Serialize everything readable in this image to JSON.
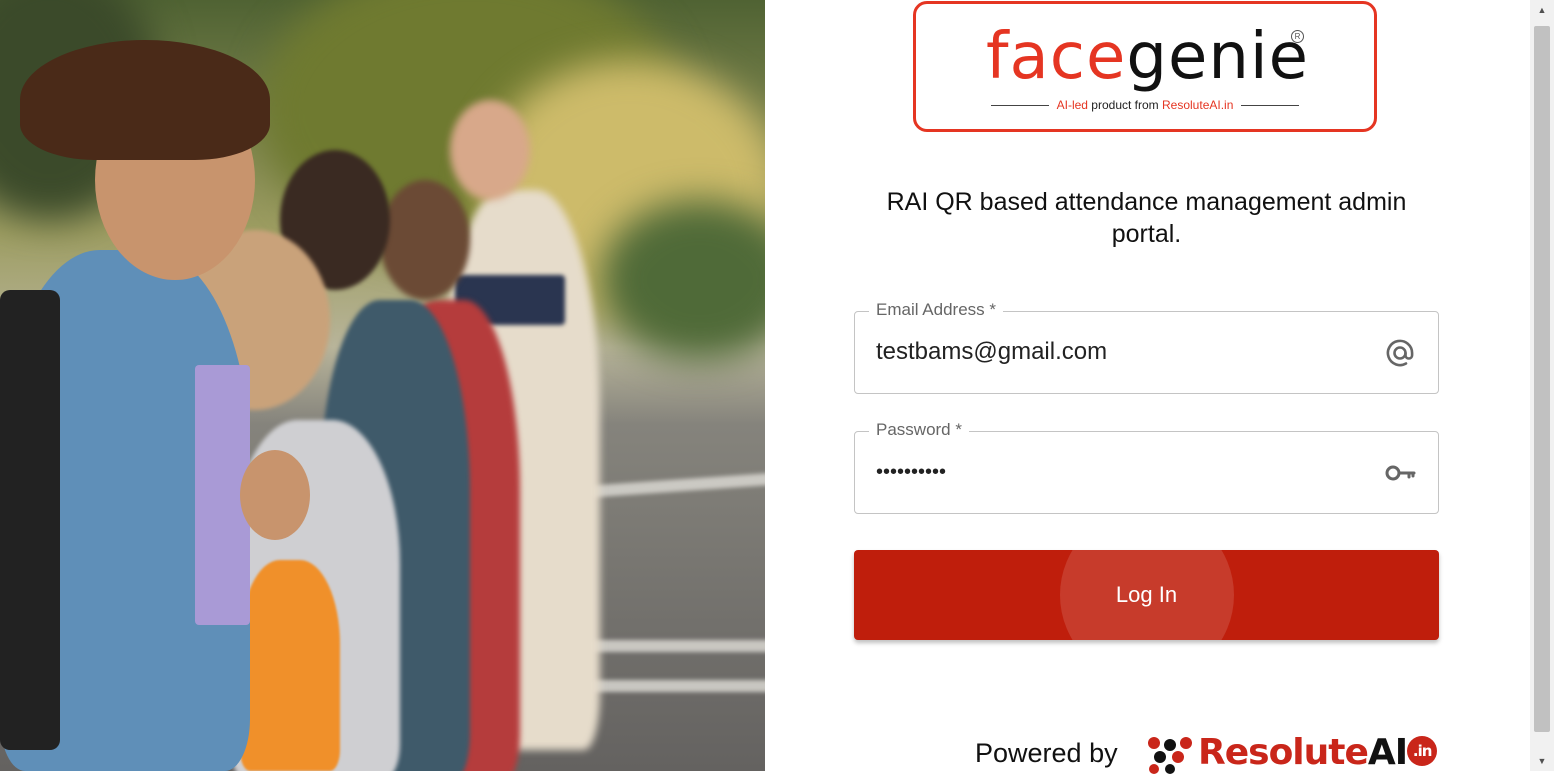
{
  "logo": {
    "word_face": "face",
    "word_genie": "genie",
    "registered": "R",
    "tagline_red": "AI-led",
    "tagline_mid": " product from ",
    "tagline_brand": "ResoluteAI.in"
  },
  "subtitle": "RAI QR based attendance management admin portal.",
  "email_field": {
    "label": "Email Address *",
    "value": "testbams@gmail.com",
    "icon": "at-icon"
  },
  "password_field": {
    "label": "Password *",
    "value": "••••••••••",
    "icon": "key-icon"
  },
  "login_button": {
    "label": "Log In"
  },
  "footer": {
    "powered_by": "Powered by",
    "brand_resolute": "Resolute",
    "brand_ai": "AI",
    "brand_badge": ".in"
  },
  "colors": {
    "brand_red": "#e53522",
    "button_red": "#bf1e0c"
  }
}
